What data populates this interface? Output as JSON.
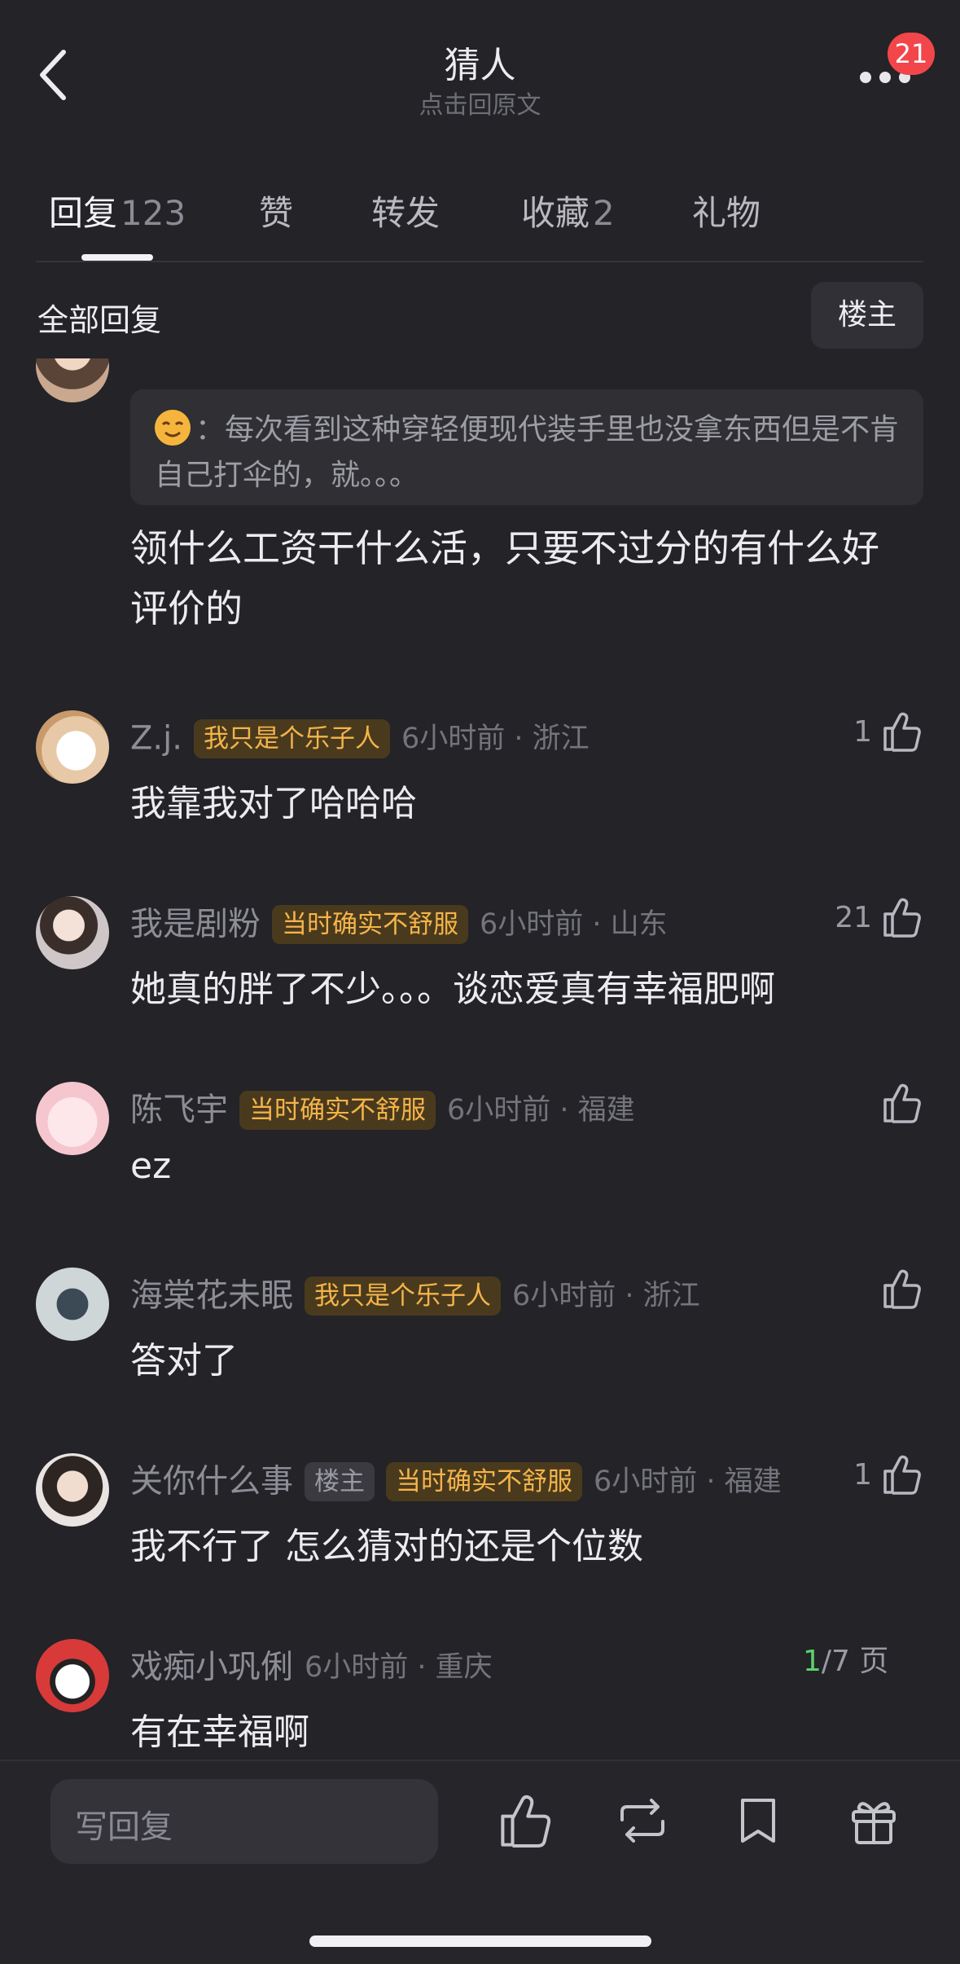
{
  "header": {
    "title": "猜人",
    "subtitle": "点击回原文",
    "notification_badge": "21"
  },
  "tabs": [
    {
      "label": "回复",
      "count": "123"
    },
    {
      "label": "赞",
      "count": ""
    },
    {
      "label": "转发",
      "count": ""
    },
    {
      "label": "收藏",
      "count": "2"
    },
    {
      "label": "礼物",
      "count": ""
    }
  ],
  "filter": {
    "all_replies_label": "全部回复",
    "owner_only_label": "楼主"
  },
  "quoted_reply": {
    "emoji": "☺️",
    "text": "每次看到这种穿轻便现代装手里也没拿东西但是不肯自己打伞的，就。。。",
    "reply": "领什么工资干什么活，只要不过分的有什么好评价的"
  },
  "comments": [
    {
      "username": "Z.j.",
      "tags": [
        "我只是个乐子人"
      ],
      "time": "6小时前 · 浙江",
      "likes": "1",
      "text": "我靠我对了哈哈哈"
    },
    {
      "username": "我是剧粉",
      "tags": [
        "当时确实不舒服"
      ],
      "time": "6小时前 · 山东",
      "likes": "21",
      "text": "她真的胖了不少。。。谈恋爱真有幸福肥啊"
    },
    {
      "username": "陈飞宇",
      "tags": [
        "当时确实不舒服"
      ],
      "time": "6小时前 · 福建",
      "likes": "",
      "text": "ez"
    },
    {
      "username": "海棠花未眠",
      "tags": [
        "我只是个乐子人"
      ],
      "time": "6小时前 · 浙江",
      "likes": "",
      "text": "答对了"
    },
    {
      "username": "关你什么事",
      "owner_tag": "楼主",
      "tags": [
        "当时确实不舒服"
      ],
      "time": "6小时前 · 福建",
      "likes": "1",
      "text": "我不行了 怎么猜对的还是个位数"
    },
    {
      "username": "戏痴小巩俐",
      "tags": [],
      "time": "6小时前 · 重庆",
      "likes": "",
      "text": "有在幸福啊"
    }
  ],
  "pager": {
    "current": "1",
    "total_label": "/7 页"
  },
  "bottom_bar": {
    "reply_placeholder": "写回复"
  },
  "colors": {
    "background": "#232328",
    "fan_tag": "#f4b44a",
    "badge": "#f2464b",
    "pager_current": "#5bd16a"
  },
  "icons": [
    "back-chevron-icon",
    "more-icon",
    "thumbs-up-icon",
    "repost-icon",
    "bookmark-icon",
    "gift-icon"
  ]
}
